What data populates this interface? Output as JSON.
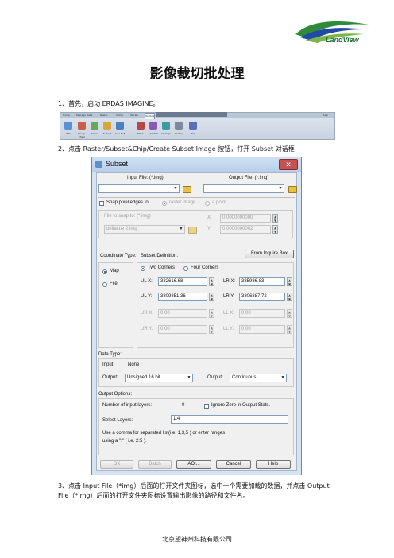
{
  "logo": {
    "text": "LandView",
    "colors": {
      "green": "#2e8b3a",
      "blue": "#1f4aa8"
    }
  },
  "title": "影像裁切批处理",
  "steps": [
    "1、首先，启动 ERDAS IMAGINE。",
    "2、点击 Raster/Subset&Chip/Create Subset Image 按钮，打开 Subset 对话框",
    "3、点击 Input File（*img）后面的打开文件夹图标，选中一个需要加载的数据，并点击 Output",
    "File（*img）后面的打开文件夹图标设置输出影像的路径和文件名。"
  ],
  "toolbar": {
    "tabs": [
      "Home",
      "Manage Data",
      "Raster",
      "Vector",
      "Terrain",
      "Toolbox",
      "Help"
    ],
    "buttons": [
      "IMA",
      "Image Chain",
      "Mosaic",
      "Subset",
      "Geo Ref",
      "Mask",
      "Spectral",
      "Change",
      "Vector",
      "AOI"
    ]
  },
  "dialog": {
    "title": "Subset",
    "close": "✕",
    "input_file_label": "Input File: (*.img)",
    "output_file_label": "Output File: (*.img)",
    "input_file_value": "",
    "output_file_value": "",
    "snap_label": "Snap pixel edges to:",
    "snap_raster": "raster image",
    "snap_point": "a point",
    "file_to_snap": "File to snap to: (*.img)",
    "snap_file_value": "dellacue 2.img",
    "snap_x_label": "X:",
    "snap_y_label": "Y:",
    "snap_x": "0.0000000000",
    "snap_y": "0.0000000002",
    "coord_type": "Coordinate Type:",
    "subset_def": "Subset Definition:",
    "from_inquire": "From Inquire Box",
    "map": "Map",
    "file": "File",
    "two_corners": "Two Corners",
    "four_corners": "Four Corners",
    "ulx_label": "UL X:",
    "uly_label": "UL Y:",
    "lrx_label": "LR X:",
    "lry_label": "LR Y:",
    "ulx": "332616.68",
    "uly": "3809851.36",
    "lrx": "335986.83",
    "lry": "3806387.72",
    "urx_label": "UR X:",
    "ury_label": "UR Y:",
    "llx_label": "LL X:",
    "lly_label": "LL Y:",
    "urx": "0.00",
    "ury": "0.00",
    "llx": "0.00",
    "lly": "0.00",
    "data_type": "Data Type:",
    "input_label": "Input:",
    "input_value": "None",
    "output_label": "Output:",
    "output_type": "Unsigned 16 bit",
    "output_label2": "Output:",
    "output_cont": "Continuous",
    "output_options": "Output Options:",
    "num_layers_label": "Number of input layers:",
    "num_layers": "0",
    "ignore_zero": "Ignore Zero in Output Stats.",
    "select_layers_label": "Select Layers:",
    "select_layers": "1:4",
    "hint1": "Use a comma for separated list(i.e. 1,3,5 ) or enter ranges",
    "hint2": "using a \":\" ( i.e. 2:5 ).",
    "ok": "OK",
    "batch": "Batch",
    "aoi": "AOI...",
    "cancel": "Cancel",
    "help": "Help"
  },
  "footer": "北京望神州科技有限公司"
}
